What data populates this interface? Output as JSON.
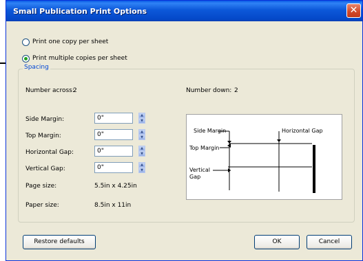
{
  "window": {
    "title": "Small Publication Print Options",
    "close_glyph": "✕"
  },
  "options": {
    "one_copy_label": "Print one copy per sheet",
    "multi_copy_label": "Print multiple copies per sheet",
    "selected": "multi"
  },
  "spacing": {
    "legend": "Spacing",
    "number_across_label": "Number across:",
    "number_across_value": "2",
    "number_down_label": "Number down:",
    "number_down_value": "2",
    "fields": [
      {
        "label": "Side Margin:",
        "value": "0\""
      },
      {
        "label": "Top Margin:",
        "value": "0\""
      },
      {
        "label": "Horizontal Gap:",
        "value": "0\""
      },
      {
        "label": "Vertical Gap:",
        "value": "0\""
      }
    ],
    "page_size_label": "Page size:",
    "page_size_value": "5.5in x 4.25in",
    "paper_size_label": "Paper size:",
    "paper_size_value": "8.5in x 11in"
  },
  "preview": {
    "side_margin": "Side Margin",
    "horizontal_gap": "Horizontal Gap",
    "top_margin": "Top Margin",
    "vertical_gap_line1": "Vertical",
    "vertical_gap_line2": "Gap"
  },
  "buttons": {
    "restore": "Restore defaults",
    "ok": "OK",
    "cancel": "Cancel"
  }
}
